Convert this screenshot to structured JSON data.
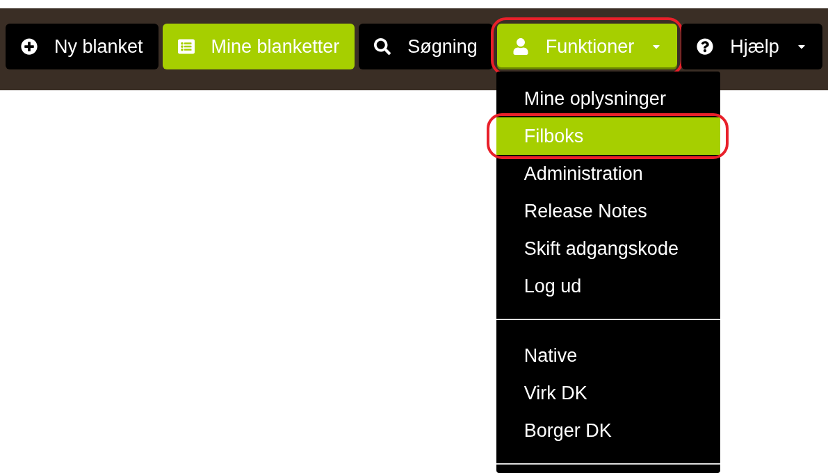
{
  "nav": {
    "items": [
      {
        "label": "Ny blanket",
        "selected": false,
        "dropdown": false,
        "expanded": false,
        "highlighted": false
      },
      {
        "label": "Mine blanketter",
        "selected": true,
        "dropdown": false,
        "expanded": false,
        "highlighted": false
      },
      {
        "label": "Søgning",
        "selected": false,
        "dropdown": false,
        "expanded": false,
        "highlighted": false
      },
      {
        "label": "Funktioner",
        "selected": true,
        "dropdown": true,
        "expanded": true,
        "highlighted": true
      },
      {
        "label": "Hjælp",
        "selected": false,
        "dropdown": true,
        "expanded": false,
        "highlighted": false
      }
    ]
  },
  "menu": {
    "sections": [
      {
        "items": [
          {
            "label": "Mine oplysninger",
            "selected": false,
            "highlighted": false
          },
          {
            "label": "Filboks",
            "selected": true,
            "highlighted": true
          },
          {
            "label": "Administration",
            "selected": false,
            "highlighted": false
          },
          {
            "label": "Release Notes",
            "selected": false,
            "highlighted": false
          },
          {
            "label": "Skift adgangskode",
            "selected": false,
            "highlighted": false
          },
          {
            "label": "Log ud",
            "selected": false,
            "highlighted": false
          }
        ]
      },
      {
        "items": [
          {
            "label": "Native",
            "selected": false,
            "highlighted": false
          },
          {
            "label": "Virk DK",
            "selected": false,
            "highlighted": false
          },
          {
            "label": "Borger DK",
            "selected": false,
            "highlighted": false
          }
        ]
      }
    ]
  }
}
